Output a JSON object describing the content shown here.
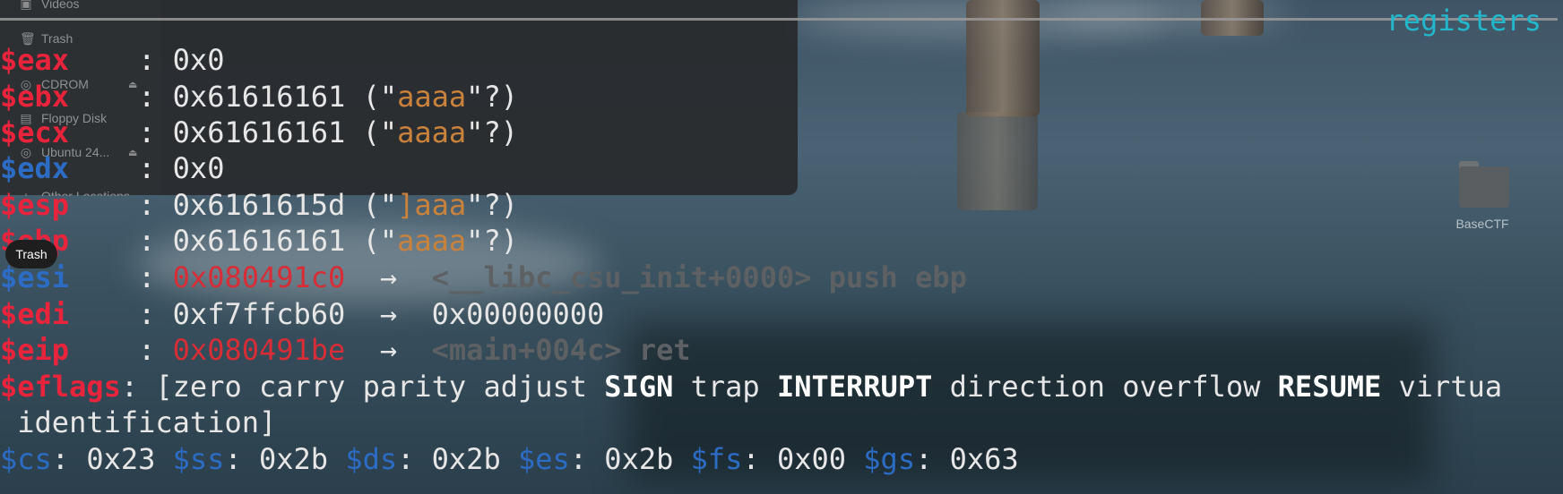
{
  "sidebar": {
    "items": [
      {
        "label": "Videos",
        "icon": "video-icon"
      },
      {
        "label": "Trash",
        "icon": "trash-icon"
      },
      {
        "label": "CDROM",
        "icon": "disc-icon",
        "eject": true
      },
      {
        "label": "Floppy Disk",
        "icon": "floppy-icon"
      },
      {
        "label": "Ubuntu 24...",
        "icon": "disc-icon",
        "eject": true
      },
      {
        "label": "Other Locations",
        "icon": "plus-icon"
      }
    ],
    "tooltip": "Trash"
  },
  "terminal": {
    "section_title": "registers",
    "registers": [
      {
        "name": "$eax",
        "value": "0x0"
      },
      {
        "name": "$ebx",
        "value": "0x61616161",
        "string": "aaaa"
      },
      {
        "name": "$ecx",
        "value": "0x61616161",
        "string": "aaaa"
      },
      {
        "name": "$edx",
        "value": "0x0"
      },
      {
        "name": "$esp",
        "value": "0x6161615d",
        "string": "]aaa"
      },
      {
        "name": "$ebp",
        "value": "0x61616161",
        "string": "aaaa"
      },
      {
        "name": "$esi",
        "value": "0x080491c0",
        "deref": "<__libc_csu_init+0000> push ebp"
      },
      {
        "name": "$edi",
        "value": "0xf7ffcb60",
        "deref": "0x00000000"
      },
      {
        "name": "$eip",
        "value": "0x080491be",
        "deref": "<main+004c> ret"
      }
    ],
    "eflags": {
      "name": "$eflags",
      "flags": [
        "zero",
        "carry",
        "parity",
        "adjust",
        "SIGN",
        "trap",
        "INTERRUPT",
        "direction",
        "overflow",
        "RESUME",
        "virtua",
        "identification"
      ]
    },
    "segments": [
      {
        "name": "$cs",
        "value": "0x23"
      },
      {
        "name": "$ss",
        "value": "0x2b"
      },
      {
        "name": "$ds",
        "value": "0x2b"
      },
      {
        "name": "$es",
        "value": "0x2b"
      },
      {
        "name": "$fs",
        "value": "0x00"
      },
      {
        "name": "$gs",
        "value": "0x63"
      }
    ]
  },
  "desktop": {
    "folder_label": "BaseCTF"
  },
  "colors": {
    "register_red": "#e8243c",
    "register_blue": "#2c6cc4",
    "string_orange": "#c8823c",
    "title_teal": "#23b7cc"
  }
}
